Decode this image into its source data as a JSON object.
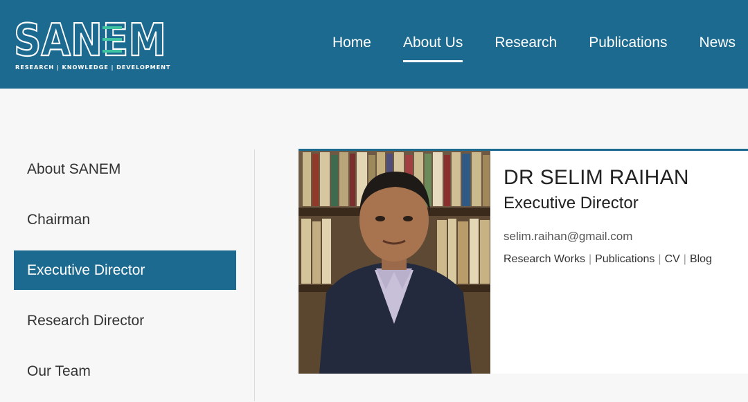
{
  "brand": {
    "logo_text": "SANEM",
    "tagline": "RESEARCH | KNOWLEDGE | DEVELOPMENT"
  },
  "nav": {
    "items": [
      {
        "label": "Home"
      },
      {
        "label": "About Us"
      },
      {
        "label": "Research"
      },
      {
        "label": "Publications"
      },
      {
        "label": "News"
      }
    ],
    "active": "About Us"
  },
  "sidebar": {
    "items": [
      {
        "label": "About SANEM"
      },
      {
        "label": "Chairman"
      },
      {
        "label": "Executive Director"
      },
      {
        "label": "Research Director"
      },
      {
        "label": "Our Team"
      }
    ],
    "active": "Executive Director"
  },
  "profile": {
    "name": "DR SELIM RAIHAN",
    "title": "Executive Director",
    "email": "selim.raihan@gmail.com",
    "links": [
      {
        "label": "Research Works"
      },
      {
        "label": "Publications"
      },
      {
        "label": "CV"
      },
      {
        "label": "Blog"
      }
    ],
    "separator": "|"
  },
  "colors": {
    "accent": "#1d6a91",
    "logo_green": "#3ec4a0"
  }
}
